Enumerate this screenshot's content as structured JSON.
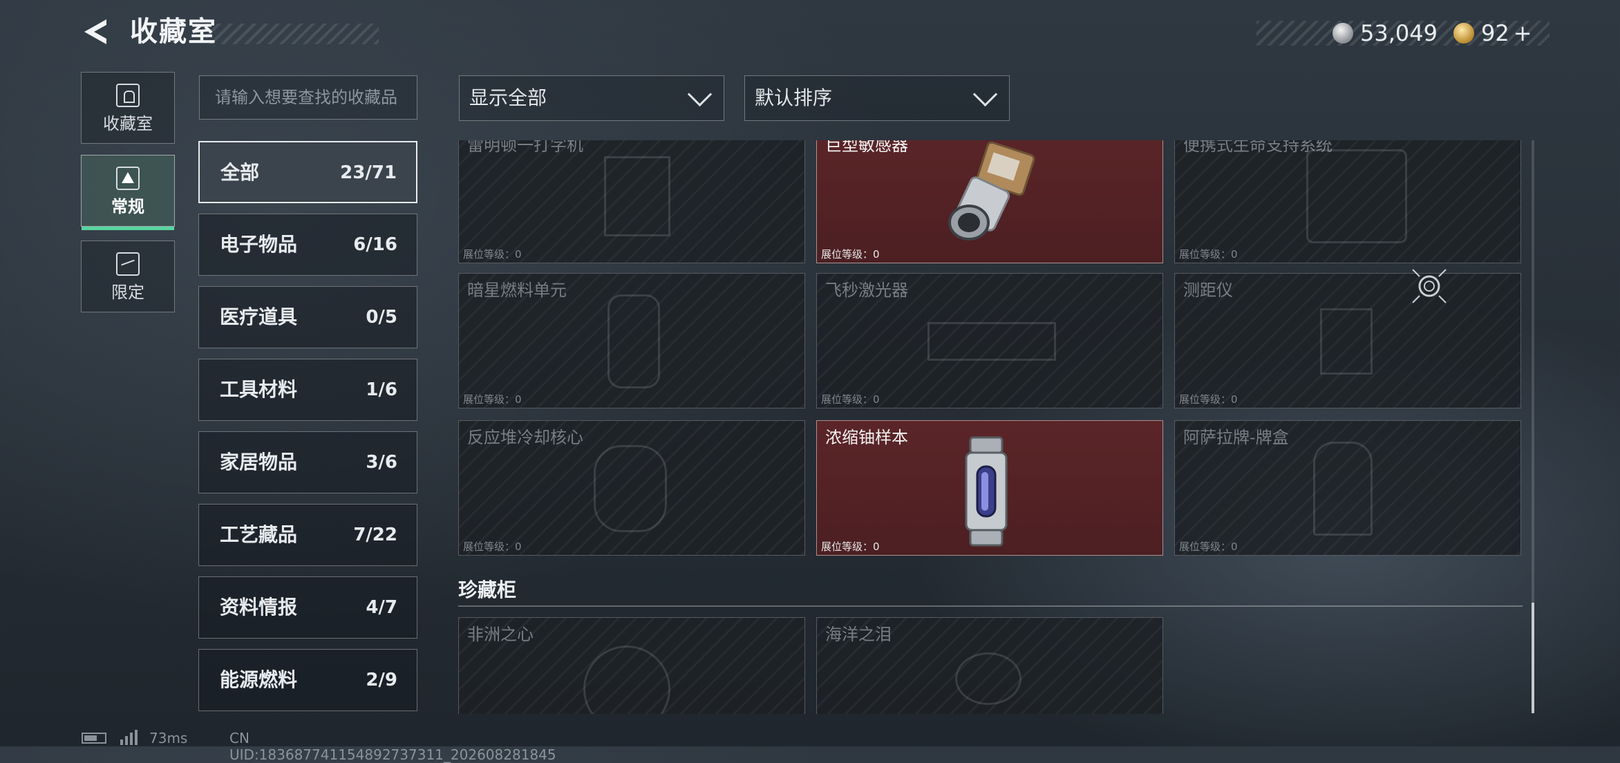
{
  "header": {
    "title": "收藏室",
    "currency1_value": "53,049",
    "currency1_icon": "silver-coin-icon",
    "currency2_value": "92",
    "currency2_add": "+",
    "currency2_icon": "gold-coin-icon"
  },
  "nav": [
    {
      "label": "收藏室",
      "icon": "collection-room-icon",
      "active": false
    },
    {
      "label": "常规",
      "icon": "regular-icon",
      "active": true
    },
    {
      "label": "限定",
      "icon": "limited-icon",
      "active": false
    }
  ],
  "search": {
    "placeholder": "请输入想要查找的收藏品"
  },
  "filters": {
    "show": "显示全部",
    "sort": "默认排序"
  },
  "categories": [
    {
      "name": "全部",
      "count": "23/71",
      "active": true
    },
    {
      "name": "电子物品",
      "count": "6/16"
    },
    {
      "name": "医疗道具",
      "count": "0/5"
    },
    {
      "name": "工具材料",
      "count": "1/6"
    },
    {
      "name": "家居物品",
      "count": "3/6"
    },
    {
      "name": "工艺藏品",
      "count": "7/22"
    },
    {
      "name": "资料情报",
      "count": "4/7"
    },
    {
      "name": "能源燃料",
      "count": "2/9"
    }
  ],
  "items": [
    {
      "name": "雷明顿一打字机",
      "level": "展位等级：0",
      "owned": false
    },
    {
      "name": "巨型敏感器",
      "level": "展位等级：0",
      "owned": true
    },
    {
      "name": "便携式生命支持系统",
      "level": "展位等级：0",
      "owned": false
    },
    {
      "name": "暗星燃料单元",
      "level": "展位等级：0",
      "owned": false
    },
    {
      "name": "飞秒激光器",
      "level": "展位等级：0",
      "owned": false
    },
    {
      "name": "测距仪",
      "level": "展位等级：0",
      "owned": false
    },
    {
      "name": "反应堆冷却核心",
      "level": "展位等级：0",
      "owned": false
    },
    {
      "name": "浓缩铀样本",
      "level": "展位等级：0",
      "owned": true
    },
    {
      "name": "阿萨拉牌-牌盒",
      "level": "展位等级：0",
      "owned": false
    }
  ],
  "section": {
    "title": "珍藏柜"
  },
  "treasures": [
    {
      "name": "非洲之心"
    },
    {
      "name": "海洋之泪"
    }
  ],
  "footer": {
    "ping": "73ms",
    "uid": "CN UID:183687741154892737311_202608281845"
  }
}
